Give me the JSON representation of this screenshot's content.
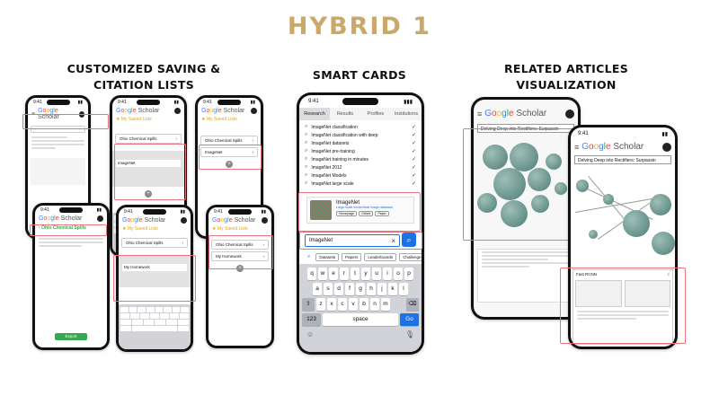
{
  "title": "HYBRID 1",
  "sections": {
    "left": "CUSTOMIZED SAVING & CITATION LISTS",
    "center": "SMART CARDS",
    "right": "RELATED ARTICLES VISUALIZATION"
  },
  "brand": {
    "google": "Google",
    "scholar": "Scholar"
  },
  "time": "9:41",
  "left_screens": {
    "lists_title": "My Saved Lists",
    "list_ohio": "Ohio Chemical Spills",
    "list_imagenet": "ImageNet",
    "list_homework": "My Homework",
    "export_label": "Export"
  },
  "center": {
    "tabs": [
      "Research",
      "Results",
      "Profiles",
      "Institutions"
    ],
    "suggestions": [
      "ImageNet classification",
      "ImageNet classification with deep",
      "ImageNet datasets",
      "ImageNet pre-training",
      "ImageNet training in minutes",
      "ImageNet 2012",
      "ImageNet Models",
      "ImageNet large scale"
    ],
    "card_title": "ImageNet",
    "card_subtitle": "Large-scale hierarchical image database",
    "card_buttons": [
      "Homepage",
      "Github",
      "Paper"
    ],
    "search_value": "ImageNet",
    "chips": [
      "Datasets",
      "Papers",
      "Leaderboards",
      "Challenge"
    ],
    "keys_row1": [
      "q",
      "w",
      "e",
      "r",
      "t",
      "y",
      "u",
      "i",
      "o",
      "p"
    ],
    "keys_row2": [
      "a",
      "s",
      "d",
      "f",
      "g",
      "h",
      "j",
      "k",
      "l"
    ],
    "keys_row3": [
      "z",
      "x",
      "c",
      "v",
      "b",
      "n",
      "m"
    ],
    "key_123": "123",
    "key_space": "space",
    "key_go": "Go"
  },
  "right": {
    "search_value": "Delving Deep into Rectifiers: Surpassin",
    "fp_label": "Fast RCNN"
  },
  "colors": {
    "accent": "#c9a86a",
    "highlight": "#e8737a",
    "google_blue": "#1a73e8"
  }
}
